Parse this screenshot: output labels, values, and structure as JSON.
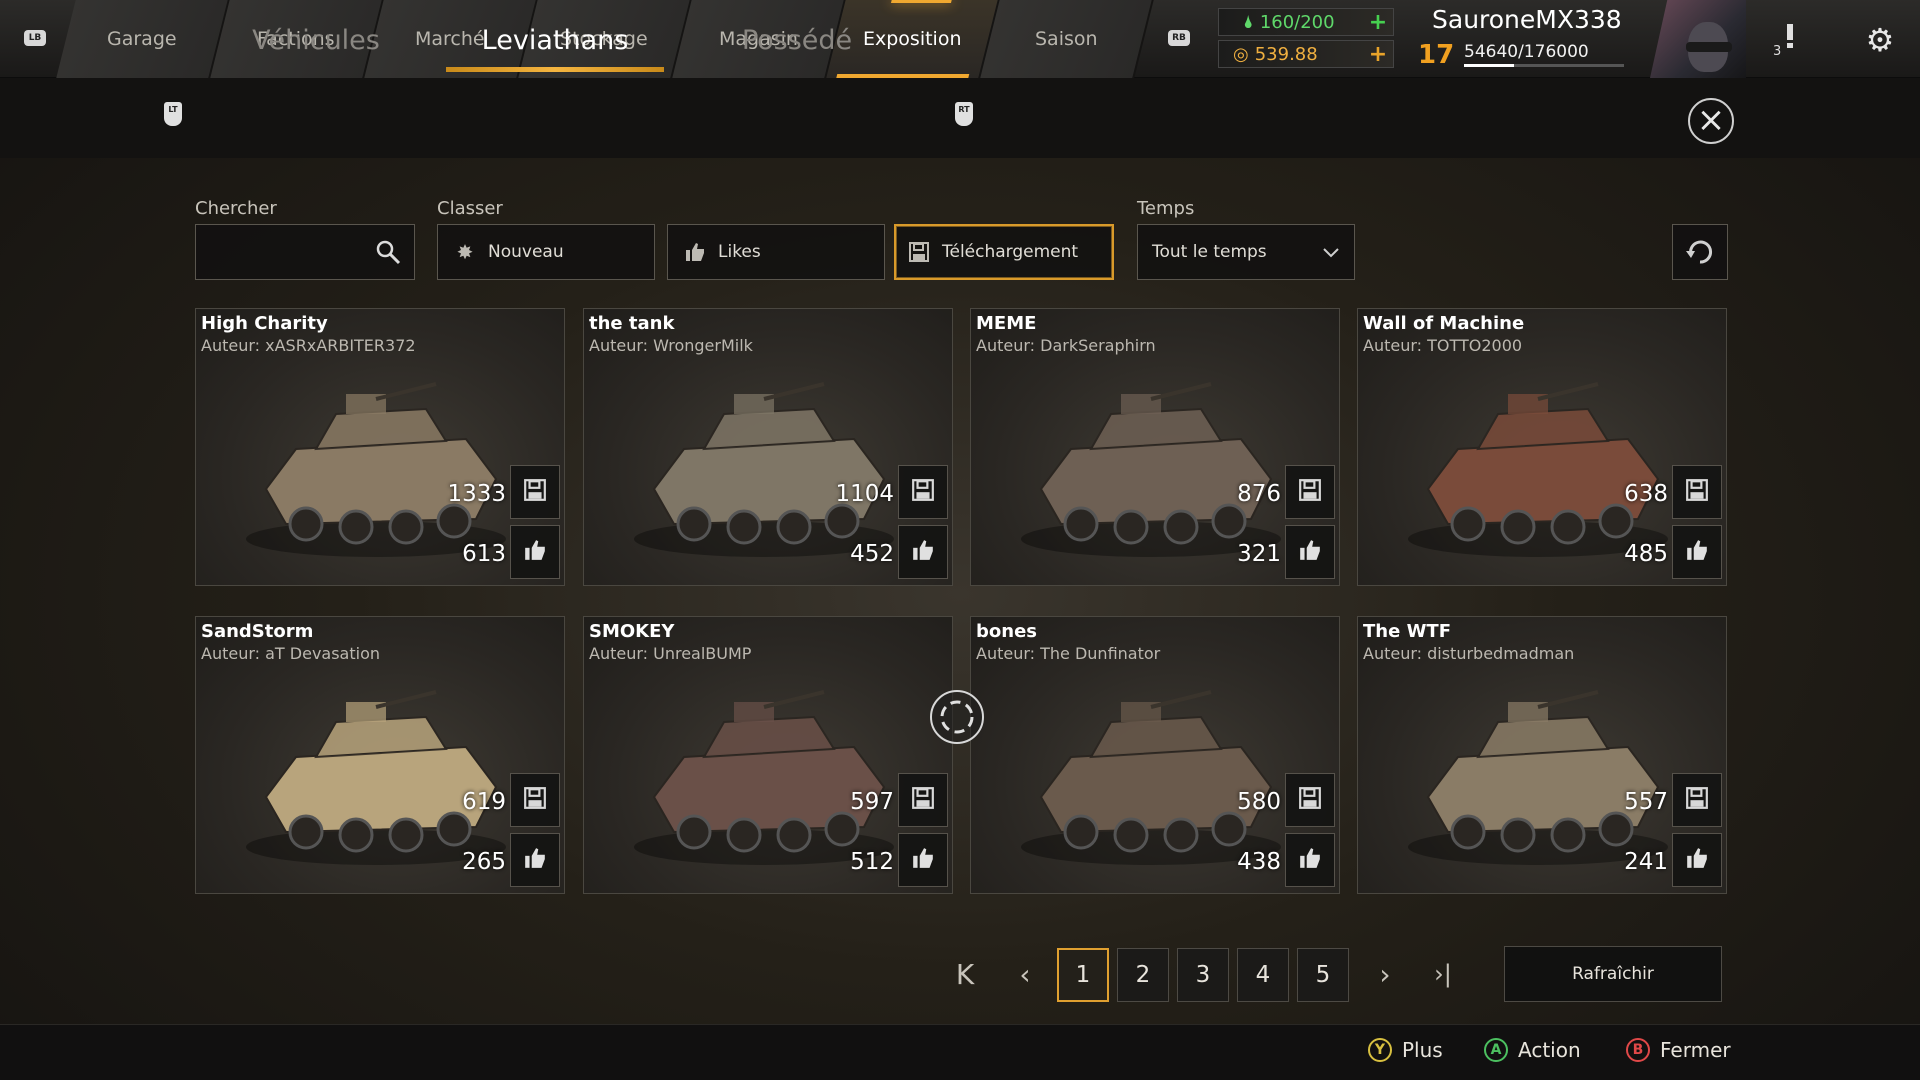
{
  "colors": {
    "accent": "#f0a830",
    "fuel": "#36c44a",
    "coins": "#e8a32a",
    "level": "#f0a020"
  },
  "topbar": {
    "left_bumper": "LB",
    "right_bumper": "RB",
    "tabs": [
      {
        "label": "Garage"
      },
      {
        "label": "Factions"
      },
      {
        "label": "Marché"
      },
      {
        "label": "Stockage"
      },
      {
        "label": "Magasin"
      },
      {
        "label": "Exposition",
        "active": true
      },
      {
        "label": "Saison"
      }
    ],
    "fuel": "160/200",
    "coins": "539.88",
    "username": "SauroneMX338",
    "level": "17",
    "xp": "54640/176000",
    "xp_fraction": 0.31,
    "notification_count": "3"
  },
  "subtabs": {
    "left_trigger": "LT",
    "right_trigger": "RT",
    "items": [
      {
        "label": "Véhicules"
      },
      {
        "label": "Leviathans",
        "active": true
      },
      {
        "label": "Possédé"
      }
    ]
  },
  "filters": {
    "search_label": "Chercher",
    "search_value": "",
    "sort_label": "Classer",
    "sort_options": [
      {
        "label": "Nouveau",
        "icon": "sun-icon"
      },
      {
        "label": "Likes",
        "icon": "thumbs-up-icon"
      },
      {
        "label": "Téléchargement",
        "icon": "save-icon",
        "selected": true
      }
    ],
    "time_label": "Temps",
    "time_value": "Tout le temps"
  },
  "cards": [
    {
      "name": "High Charity",
      "author": "Auteur: xASRxARBITER372",
      "downloads": "1333",
      "likes": "613"
    },
    {
      "name": "the tank",
      "author": "Auteur: WrongerMilk",
      "downloads": "1104",
      "likes": "452"
    },
    {
      "name": "MEME",
      "author": "Auteur: DarkSeraphirn",
      "downloads": "876",
      "likes": "321"
    },
    {
      "name": "Wall of Machine",
      "author": "Auteur: TOTTO2000",
      "downloads": "638",
      "likes": "485"
    },
    {
      "name": "SandStorm",
      "author": "Auteur: aT Devasation",
      "downloads": "619",
      "likes": "265"
    },
    {
      "name": "SMOKEY",
      "author": "Auteur: UnrealBUMP",
      "downloads": "597",
      "likes": "512"
    },
    {
      "name": "bones",
      "author": "Auteur: The Dunfinator",
      "downloads": "580",
      "likes": "438"
    },
    {
      "name": "The WTF",
      "author": "Auteur: disturbedmadman",
      "downloads": "557",
      "likes": "241"
    }
  ],
  "pagination": {
    "first": "K",
    "prev": "‹",
    "pages": [
      "1",
      "2",
      "3",
      "4",
      "5"
    ],
    "current": "1",
    "next": "›",
    "last": "›|",
    "refresh_label": "Rafraîchir"
  },
  "footer": {
    "hints": [
      {
        "button": "Y",
        "label": "Plus",
        "color": "#d8c040"
      },
      {
        "button": "A",
        "label": "Action",
        "color": "#4cc060"
      },
      {
        "button": "B",
        "label": "Fermer",
        "color": "#e04848"
      }
    ]
  }
}
